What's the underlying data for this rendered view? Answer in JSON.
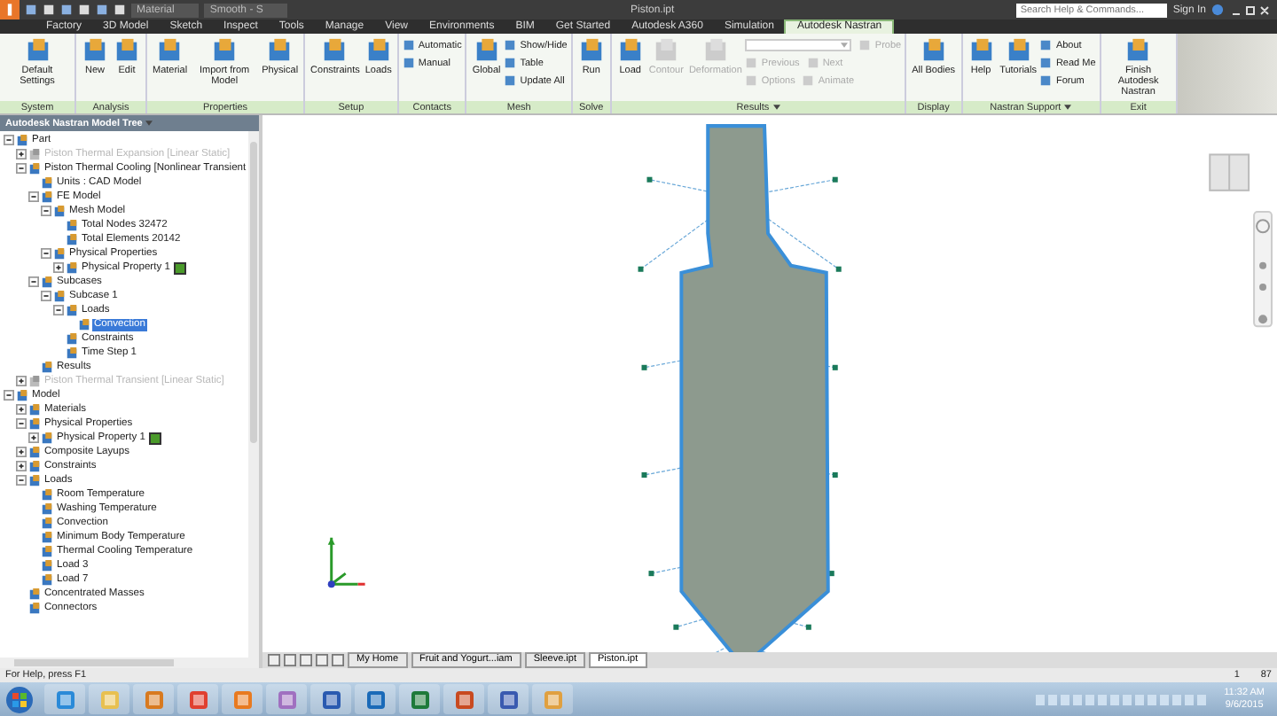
{
  "title_bar": {
    "material": "Material",
    "appearance": "Smooth - S",
    "title": "Piston.ipt",
    "search": {
      "placeholder": "Search Help & Commands..."
    },
    "sign_in": "Sign In"
  },
  "tabs": [
    {
      "label": "Factory",
      "selected": false
    },
    {
      "label": "3D Model",
      "selected": false
    },
    {
      "label": "Sketch",
      "selected": false
    },
    {
      "label": "Inspect",
      "selected": false
    },
    {
      "label": "Tools",
      "selected": false
    },
    {
      "label": "Manage",
      "selected": false
    },
    {
      "label": "View",
      "selected": false
    },
    {
      "label": "Environments",
      "selected": false
    },
    {
      "label": "BIM",
      "selected": false
    },
    {
      "label": "Get Started",
      "selected": false
    },
    {
      "label": "Autodesk A360",
      "selected": false
    },
    {
      "label": "Simulation",
      "selected": false
    },
    {
      "label": "Autodesk Nastran",
      "selected": true
    }
  ],
  "ribbon": [
    {
      "label": "System",
      "menu": false,
      "items": [
        {
          "kind": "large",
          "label": "Default Settings",
          "disabled": false
        }
      ]
    },
    {
      "label": "Analysis",
      "menu": false,
      "items": [
        {
          "kind": "large",
          "label": "New",
          "disabled": false
        },
        {
          "kind": "large",
          "label": "Edit",
          "disabled": false
        }
      ]
    },
    {
      "label": "Properties",
      "menu": false,
      "items": [
        {
          "kind": "large",
          "label": "Material",
          "disabled": false
        },
        {
          "kind": "large",
          "label": "Import from Model",
          "disabled": false
        },
        {
          "kind": "large",
          "label": "Physical",
          "disabled": false
        }
      ]
    },
    {
      "label": "Setup",
      "menu": false,
      "items": [
        {
          "kind": "large",
          "label": "Constraints",
          "disabled": false
        },
        {
          "kind": "large",
          "label": "Loads",
          "disabled": false
        }
      ]
    },
    {
      "label": "Contacts",
      "menu": false,
      "items": [
        {
          "kind": "stack",
          "items": [
            {
              "kind": "small",
              "label": "Automatic",
              "disabled": false
            },
            {
              "kind": "small",
              "label": "Manual",
              "disabled": false
            }
          ]
        }
      ]
    },
    {
      "label": "Mesh",
      "menu": false,
      "items": [
        {
          "kind": "large",
          "label": "Global",
          "disabled": false
        },
        {
          "kind": "stack",
          "items": [
            {
              "kind": "small",
              "label": "Show/Hide",
              "disabled": false
            },
            {
              "kind": "small",
              "label": "Table",
              "disabled": false
            },
            {
              "kind": "small",
              "label": "Update All",
              "disabled": false
            }
          ]
        }
      ]
    },
    {
      "label": "Solve",
      "menu": false,
      "items": [
        {
          "kind": "large",
          "label": "Run",
          "disabled": false
        }
      ]
    },
    {
      "label": "Results",
      "menu": true,
      "items": [
        {
          "kind": "large",
          "label": "Load",
          "disabled": false
        },
        {
          "kind": "large",
          "label": "Contour",
          "disabled": true
        },
        {
          "kind": "large",
          "label": "Deformation",
          "disabled": true
        },
        {
          "kind": "stack",
          "items": [
            {
              "kind": "dropdown",
              "label": "Probe",
              "disabled": true
            },
            {
              "kind": "pair",
              "label": "Previous",
              "second": "Next",
              "disabled": true
            },
            {
              "kind": "pair",
              "label": "Options",
              "second": "Animate",
              "disabled": true
            }
          ]
        }
      ]
    },
    {
      "label": "Display",
      "menu": false,
      "items": [
        {
          "kind": "large",
          "label": "All Bodies",
          "disabled": false
        }
      ]
    },
    {
      "label": "Nastran Support",
      "menu": true,
      "items": [
        {
          "kind": "large",
          "label": "Help",
          "disabled": false
        },
        {
          "kind": "large",
          "label": "Tutorials",
          "disabled": false
        },
        {
          "kind": "stack",
          "items": [
            {
              "kind": "small",
              "label": "About",
              "disabled": false
            },
            {
              "kind": "small",
              "label": "Read Me",
              "disabled": false
            },
            {
              "kind": "small",
              "label": "Forum",
              "disabled": false
            }
          ]
        }
      ]
    },
    {
      "label": "Exit",
      "menu": false,
      "items": [
        {
          "kind": "large",
          "label": "Finish Autodesk Nastran",
          "disabled": false
        }
      ]
    }
  ],
  "model_tree": {
    "title": "Autodesk Nastran Model Tree",
    "nodes": [
      {
        "label": "Part",
        "expanded": true,
        "children": [
          {
            "label": "Piston Thermal Expansion [Linear Static]",
            "expanded": false,
            "disabled": true
          },
          {
            "label": "Piston Thermal Cooling [Nonlinear Transient",
            "expanded": true,
            "children": [
              {
                "label": "Units : CAD Model"
              },
              {
                "label": "FE Model",
                "expanded": true,
                "children": [
                  {
                    "label": "Mesh Model",
                    "expanded": true,
                    "children": [
                      {
                        "label": "Total Nodes 32472"
                      },
                      {
                        "label": "Total Elements 20142"
                      }
                    ]
                  },
                  {
                    "label": "Physical Properties",
                    "expanded": true,
                    "children": [
                      {
                        "label": "Physical Property 1",
                        "expanded": false,
                        "color": "#4a9a2a"
                      }
                    ]
                  }
                ]
              },
              {
                "label": "Subcases",
                "expanded": true,
                "children": [
                  {
                    "label": "Subcase 1",
                    "expanded": true,
                    "children": [
                      {
                        "label": "Loads",
                        "expanded": true,
                        "children": [
                          {
                            "label": "Convection",
                            "selected": true
                          }
                        ]
                      },
                      {
                        "label": "Constraints"
                      },
                      {
                        "label": "Time Step 1"
                      }
                    ]
                  }
                ]
              },
              {
                "label": "Results"
              }
            ]
          },
          {
            "label": "Piston Thermal Transient [Linear Static]",
            "expanded": false,
            "disabled": true
          }
        ]
      },
      {
        "label": "Model",
        "expanded": true,
        "children": [
          {
            "label": "Materials",
            "expanded": false
          },
          {
            "label": "Physical Properties",
            "expanded": true,
            "children": [
              {
                "label": "Physical Property 1",
                "expanded": false,
                "color": "#4a9a2a"
              }
            ]
          },
          {
            "label": "Composite Layups",
            "expanded": false
          },
          {
            "label": "Constraints",
            "expanded": false
          },
          {
            "label": "Loads",
            "expanded": true,
            "children": [
              {
                "label": "Room Temperature"
              },
              {
                "label": "Washing Temperature"
              },
              {
                "label": "Convection"
              },
              {
                "label": "Minimum Body Temperature"
              },
              {
                "label": "Thermal Cooling Temperature"
              },
              {
                "label": "Load 3"
              },
              {
                "label": "Load 7"
              }
            ]
          },
          {
            "label": "Concentrated Masses"
          },
          {
            "label": "Connectors"
          }
        ]
      }
    ]
  },
  "document_tabs": [
    {
      "label": "My Home",
      "selected": false
    },
    {
      "label": "Fruit and Yogurt...iam",
      "selected": false
    },
    {
      "label": "Sleeve.ipt",
      "selected": false
    },
    {
      "label": "Piston.ipt",
      "selected": true
    }
  ],
  "status_bar": {
    "help": "For Help, press F1",
    "value_1": "1",
    "value_2": "87"
  },
  "taskbar": {
    "time": "11:32 AM",
    "date": "9/6/2015"
  }
}
